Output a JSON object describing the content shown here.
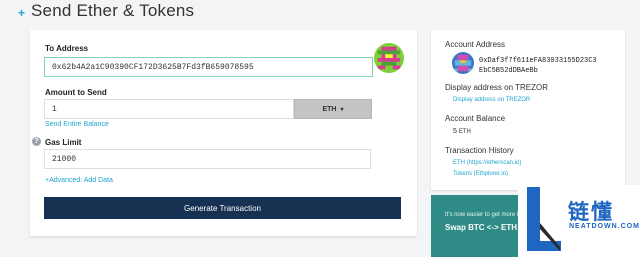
{
  "header": {
    "icon": "plus-icon",
    "icon_glyph": "+",
    "title": "Send Ether & Tokens"
  },
  "send_form": {
    "to_address_label": "To Address",
    "to_address_value": "0x62b4A2a1C90390CF172D3625B7Fd3fB659078595",
    "amount_label": "Amount to Send",
    "amount_value": "1",
    "currency_selected": "ETH",
    "send_entire_balance": "Send Entire Balance",
    "gas_limit_label": "Gas Limit",
    "gas_limit_value": "21000",
    "help_icon_glyph": "?",
    "advanced_link": "+Advanced: Add Data",
    "generate_button": "Generate Transaction"
  },
  "account": {
    "address_label": "Account Address",
    "address_value": "0xDaf3f7f611eFA83033155D23C3EbC5B52dDBAeBb",
    "display_on_label": "Display address on TREZOR",
    "display_on_link": "Display address on TREZOR",
    "balance_label": "Account Balance",
    "balance_amount": "5",
    "balance_unit": "ETH",
    "history_label": "Transaction History",
    "history_links": [
      "ETH (https://etherscan.io)",
      "Tokens (Ethplorer.io)"
    ]
  },
  "promo": {
    "line1": "It's now easier to get more ET",
    "line2": "Swap BTC <-> ETH"
  },
  "watermark": {
    "chinese": "链懂",
    "english": "NEATDOWN.COM"
  },
  "colors": {
    "accent": "#21a4ce",
    "primary_button": "#163151",
    "promo_bg": "#2e8b86",
    "watermark": "#1f66c1"
  }
}
